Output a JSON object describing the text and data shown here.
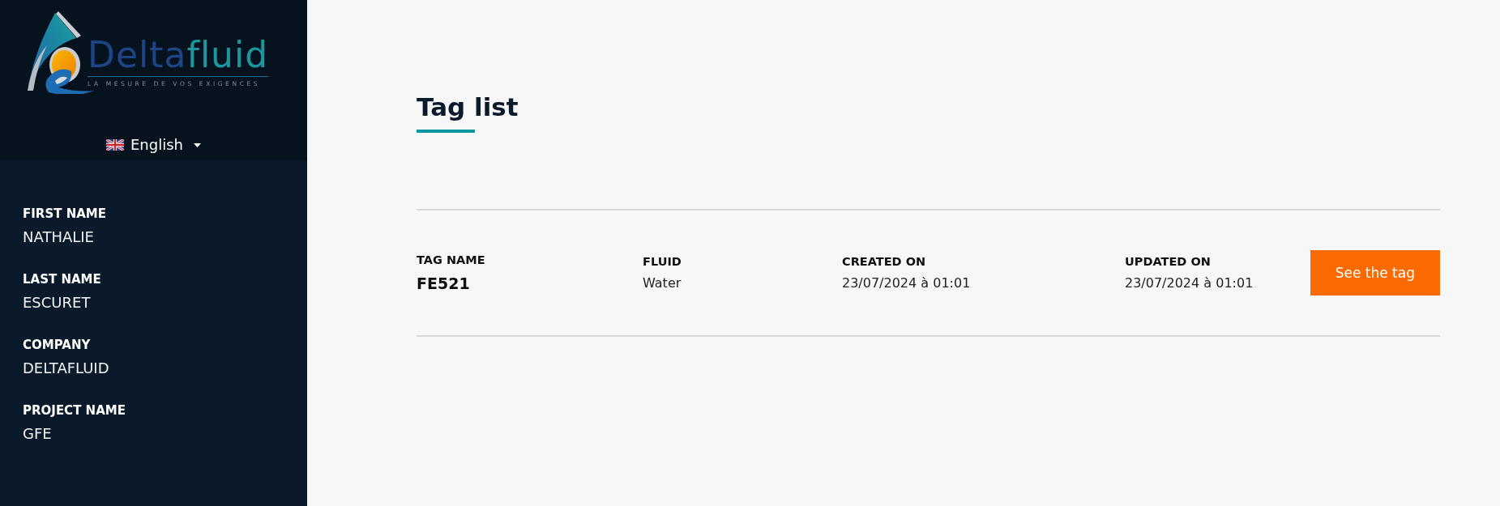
{
  "sidebar": {
    "logo": {
      "wordmark": [
        "Delta",
        "fluid"
      ],
      "tagline": "LA MESURE DE VOS EXIGENCES"
    },
    "language": {
      "label": "English"
    },
    "profile": [
      {
        "label": "FIRST NAME",
        "value": "NATHALIE"
      },
      {
        "label": "LAST NAME",
        "value": "ESCURET"
      },
      {
        "label": "COMPANY",
        "value": "DELTAFLUID"
      },
      {
        "label": "PROJECT NAME",
        "value": "GFE"
      }
    ]
  },
  "main": {
    "title": "Tag list",
    "tags": [
      {
        "fields": [
          {
            "kind": "name",
            "label": "TAG NAME",
            "value": "FE521"
          },
          {
            "kind": "text",
            "label": "FLUID",
            "value": "Water"
          },
          {
            "kind": "text",
            "label": "CREATED ON",
            "value": "23/07/2024 à 01:01"
          },
          {
            "kind": "text",
            "label": "UPDATED ON",
            "value": "23/07/2024 à 01:01"
          }
        ],
        "button": "See the tag"
      }
    ]
  }
}
